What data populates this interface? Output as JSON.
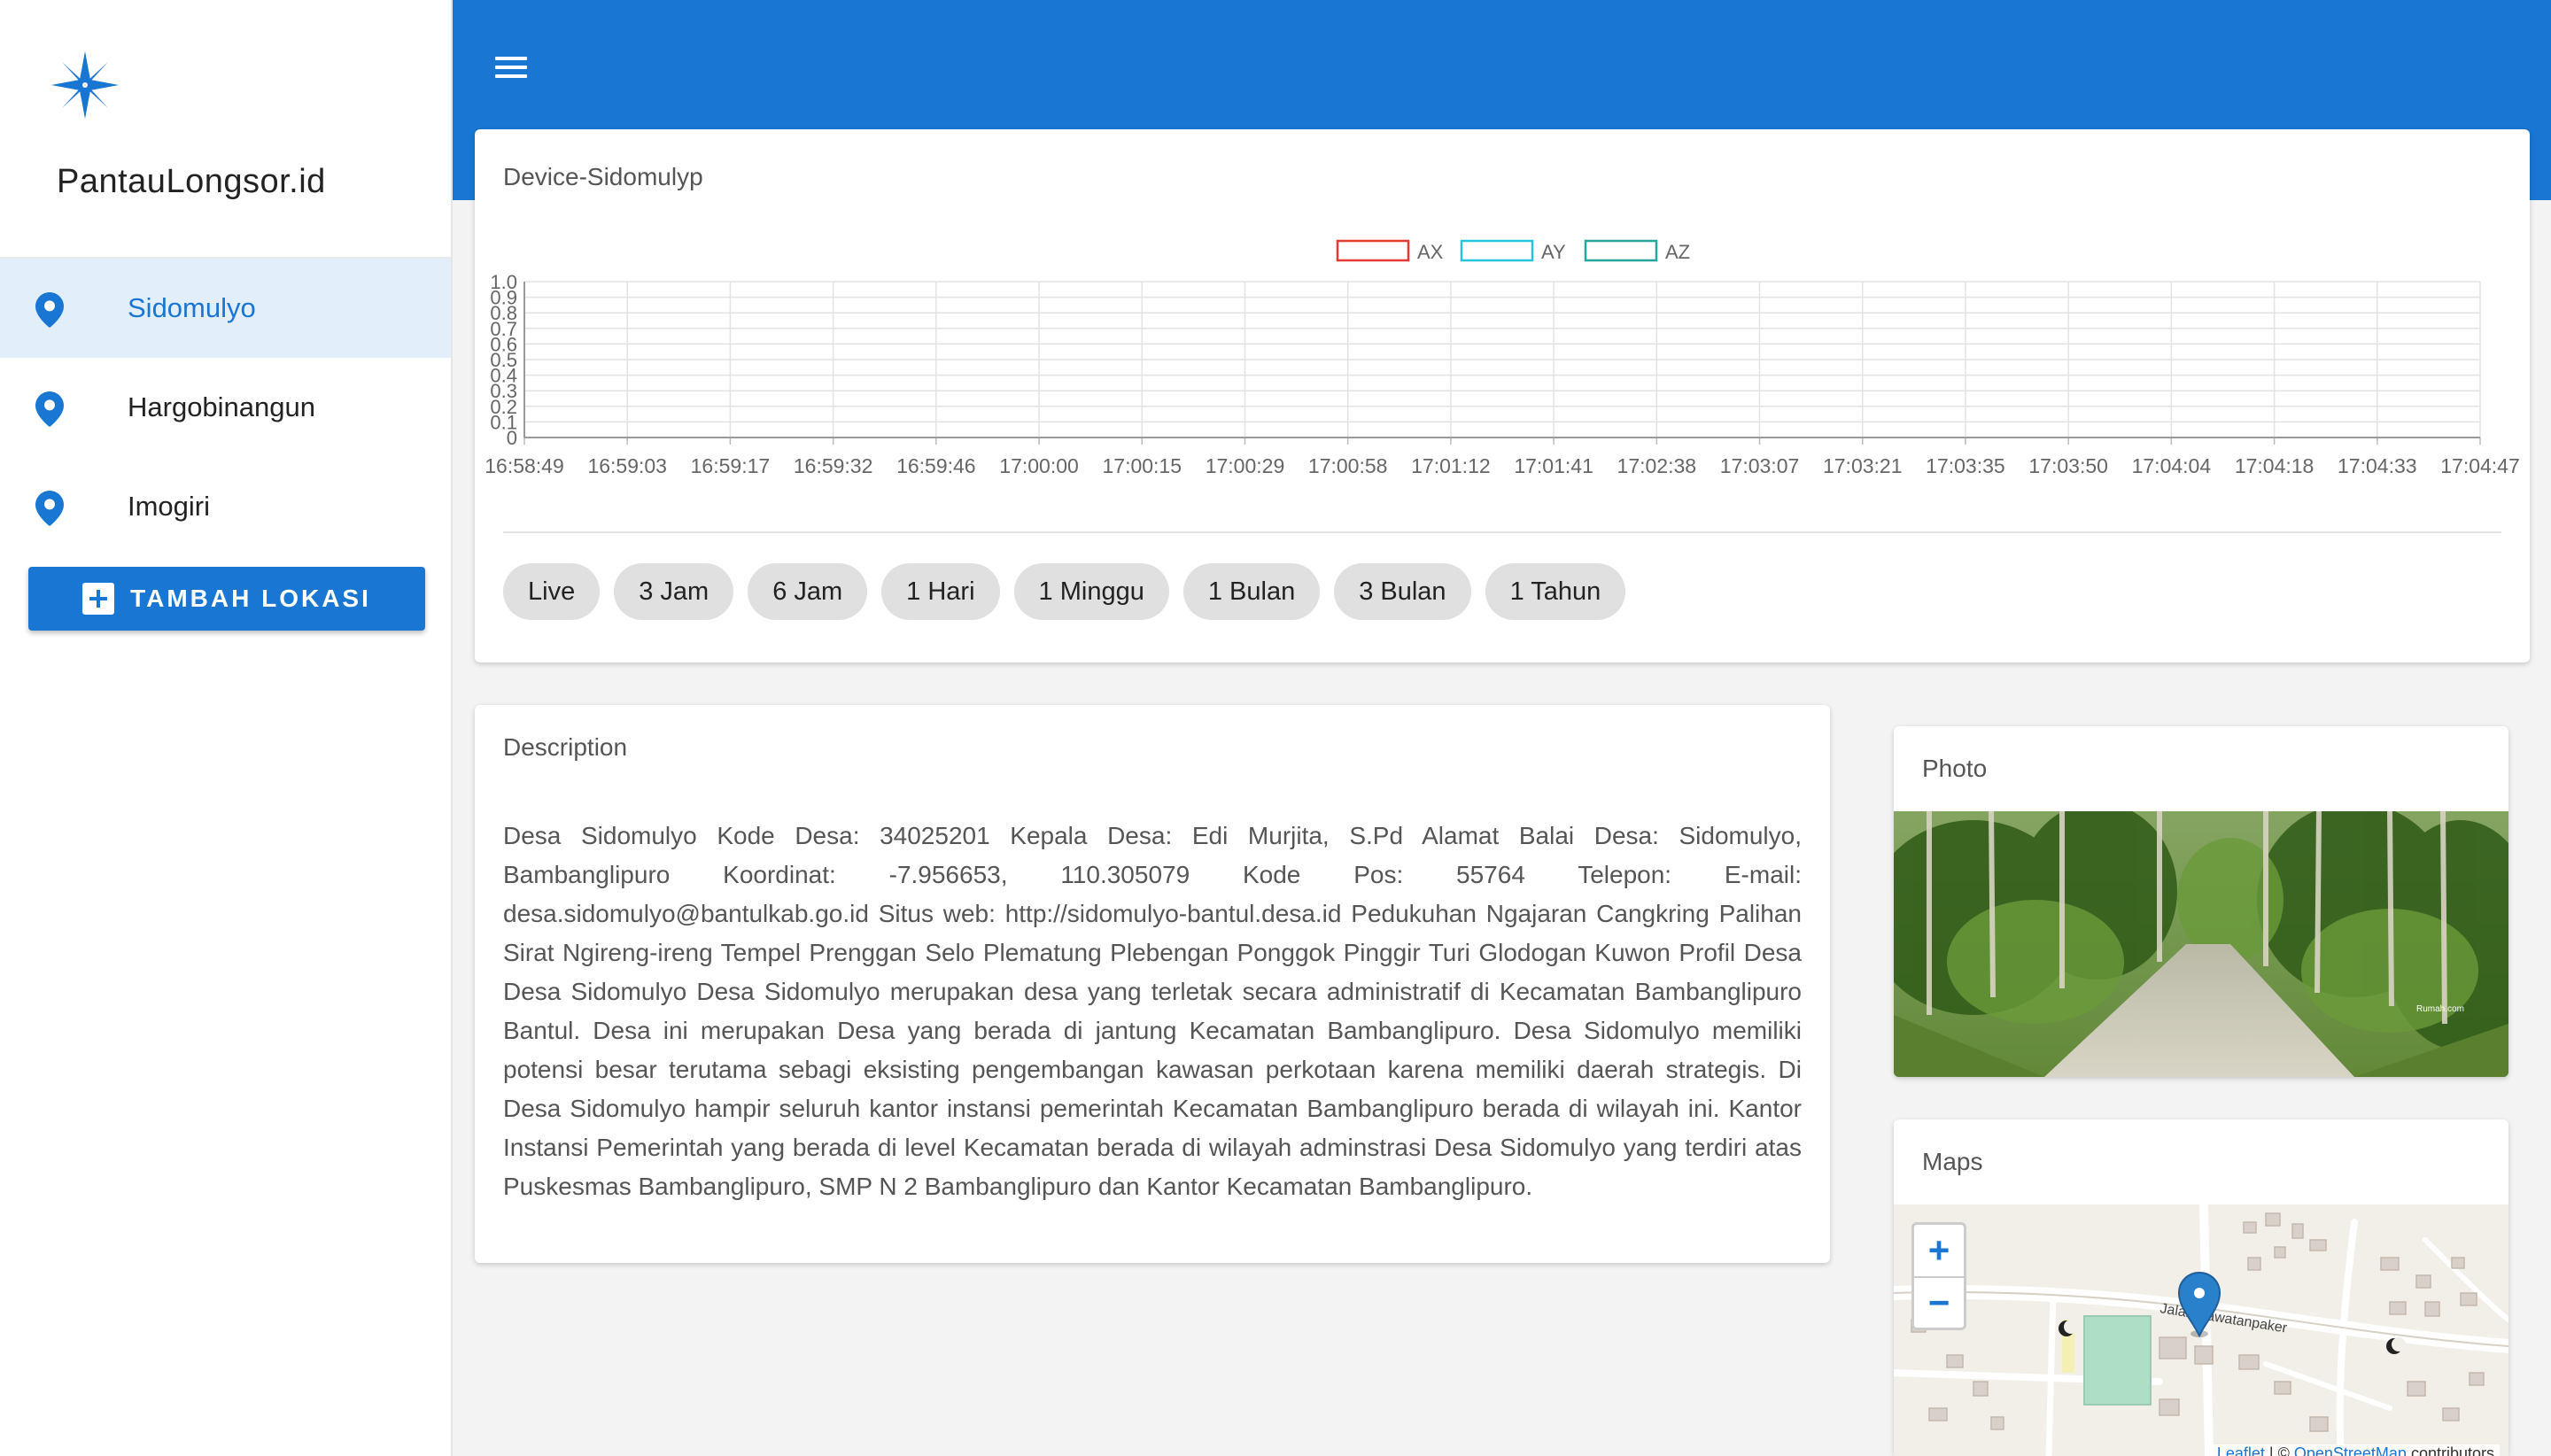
{
  "brand": {
    "name": "PantauLongsor.id",
    "logo_icon": "compass-star-icon"
  },
  "nav": {
    "items": [
      {
        "label": "Sidomulyo",
        "icon": "map-pin-icon",
        "active": true
      },
      {
        "label": "Hargobinangun",
        "icon": "map-pin-icon",
        "active": false
      },
      {
        "label": "Imogiri",
        "icon": "map-pin-icon",
        "active": false
      }
    ],
    "add_button": "TAMBAH LOKASI"
  },
  "topbar": {
    "menu_icon": "hamburger-menu-icon",
    "color": "#1976d2"
  },
  "device_card": {
    "title": "Device-Sidomulyp",
    "ranges": [
      "Live",
      "3 Jam",
      "6 Jam",
      "1 Hari",
      "1 Minggu",
      "1 Bulan",
      "3 Bulan",
      "1 Tahun"
    ]
  },
  "chart_data": {
    "type": "line",
    "title": "",
    "xlabel": "",
    "ylabel": "",
    "ylim": [
      0,
      1
    ],
    "y_ticks": [
      "0",
      "0.1",
      "0.2",
      "0.3",
      "0.4",
      "0.5",
      "0.6",
      "0.7",
      "0.8",
      "0.9",
      "1.0"
    ],
    "x": [
      "16:58:49",
      "16:59:03",
      "16:59:17",
      "16:59:32",
      "16:59:46",
      "17:00:00",
      "17:00:15",
      "17:00:29",
      "17:00:58",
      "17:01:12",
      "17:01:41",
      "17:02:38",
      "17:03:07",
      "17:03:21",
      "17:03:35",
      "17:03:50",
      "17:04:04",
      "17:04:18",
      "17:04:33",
      "17:04:47"
    ],
    "series": [
      {
        "name": "AX",
        "color": "#e53935",
        "values": []
      },
      {
        "name": "AY",
        "color": "#26c6da",
        "values": []
      },
      {
        "name": "AZ",
        "color": "#26a69a",
        "values": []
      }
    ],
    "legend": "top-center",
    "grid": true
  },
  "description": {
    "title": "Description",
    "text": "Desa Sidomulyo Kode Desa: 34025201 Kepala Desa: Edi Murjita, S.Pd Alamat Balai Desa: Sidomulyo, Bambanglipuro Koordinat: -7.956653, 110.305079 Kode Pos: 55764 Telepon: E-mail: desa.sidomulyo@bantulkab.go.id Situs web: http://sidomulyo-bantul.desa.id Pedukuhan Ngajaran Cangkring Palihan Sirat Ngireng-ireng Tempel Prenggan Selo Plematung Plebengan Ponggok Pinggir Turi Glodogan Kuwon Profil Desa Desa Sidomulyo Desa Sidomulyo merupakan desa yang terletak secara administratif di Kecamatan Bambanglipuro Bantul. Desa ini merupakan Desa yang berada di jantung Kecamatan Bambanglipuro. Desa Sidomulyo memiliki potensi besar terutama sebagi eksisting pengembangan kawasan perkotaan karena memiliki daerah strategis. Di Desa Sidomulyo hampir seluruh kantor instansi pemerintah Kecamatan Bambanglipuro berada di wilayah ini. Kantor Instansi Pemerintah yang berada di level Kecamatan berada di wilayah adminstrasi Desa Sidomulyo yang terdiri atas Puskesmas Bambanglipuro, SMP N 2 Bambanglipuro dan Kantor Kecamatan Bambanglipuro."
  },
  "photo": {
    "title": "Photo",
    "watermark": "Rumah.com"
  },
  "map": {
    "title": "Maps",
    "zoom_in": "+",
    "zoom_out": "−",
    "street_label": "Jalan Pawatanpaker",
    "attribution_leaflet": "Leaflet",
    "attribution_sep": " | © ",
    "attribution_osm": "OpenStreetMap",
    "attribution_suffix": " contributors"
  }
}
